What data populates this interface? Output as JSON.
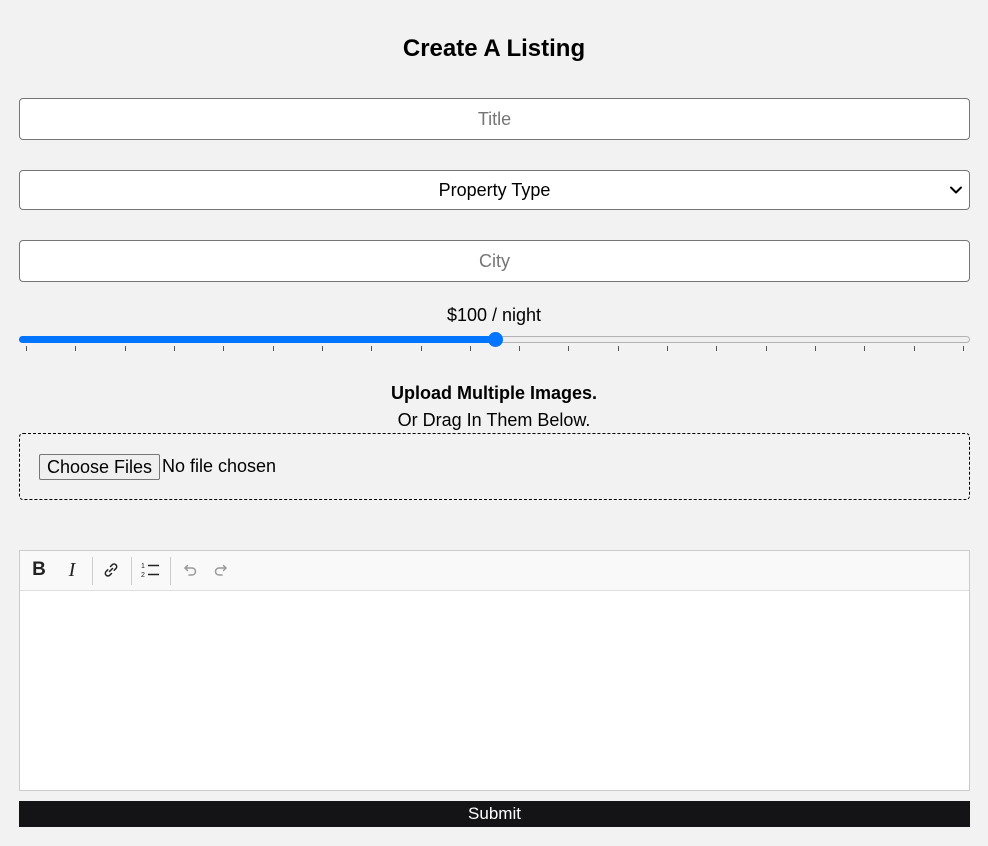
{
  "page": {
    "title": "Create A Listing"
  },
  "form": {
    "title_placeholder": "Title",
    "property_type_selected": "Property Type",
    "city_placeholder": "City",
    "price": {
      "label": "$100 / night",
      "value": 100,
      "min": 0,
      "max": 200,
      "fraction": 0.5,
      "tick_count": 20,
      "accent_color": "#0075ff"
    },
    "upload": {
      "heading": "Upload Multiple Images.",
      "subheading": "Or Drag In Them Below.",
      "button_label": "Choose Files",
      "status": "No file chosen"
    },
    "editor": {
      "toolbar": [
        {
          "name": "bold",
          "label": "B"
        },
        {
          "name": "italic",
          "label": "I"
        },
        {
          "name": "link",
          "icon": "link-icon"
        },
        {
          "name": "ordered-list",
          "icon": "ordered-list-icon"
        },
        {
          "name": "undo",
          "icon": "undo-icon"
        },
        {
          "name": "redo",
          "icon": "redo-icon"
        }
      ],
      "content": ""
    },
    "submit_label": "Submit"
  }
}
